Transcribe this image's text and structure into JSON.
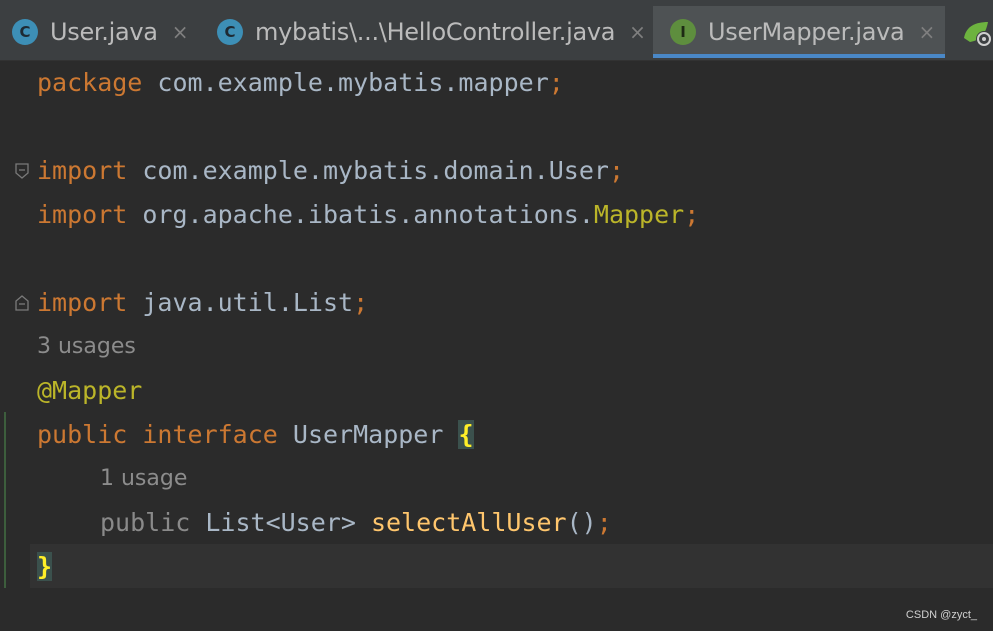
{
  "tabs": [
    {
      "label": "User.java",
      "icon": "class-icon",
      "icon_letter": "C",
      "close": "×",
      "active": false
    },
    {
      "label": "mybatis\\...\\HelloController.java",
      "icon": "class-icon",
      "icon_letter": "C",
      "close": "×",
      "active": false
    },
    {
      "label": "UserMapper.java",
      "icon": "interface-icon",
      "icon_letter": "I",
      "close": "×",
      "active": true
    }
  ],
  "code": {
    "l1": {
      "kw": "package",
      "rest": " com.example.mybatis.mapper",
      "semi": ";"
    },
    "l3": {
      "kw": "import",
      "rest": " com.example.mybatis.domain.User",
      "semi": ";"
    },
    "l4": {
      "kw": "import",
      "rest": " org.apache.ibatis.annotations.",
      "ann": "Mapper",
      "semi": ";"
    },
    "l6": {
      "kw": "import",
      "rest": " java.util.List",
      "semi": ";"
    },
    "hint1": "3 usages",
    "l8": {
      "ann": "@Mapper"
    },
    "l9": {
      "kw1": "public",
      "kw2": "interface",
      "name": " UserMapper ",
      "brace": "{"
    },
    "hint2": "1 usage",
    "l11": {
      "kw": "public",
      "type": " List<User> ",
      "fn": "selectAllUser",
      "rest": "()",
      "semi": ";"
    },
    "l12": {
      "brace": "}"
    }
  },
  "colors": {
    "background": "#2b2b2b",
    "keyword": "#cc7832",
    "annotation": "#bbb529",
    "method": "#ffc66d",
    "active_tab_underline": "#4a88c7"
  },
  "watermark": "CSDN @zyct_"
}
